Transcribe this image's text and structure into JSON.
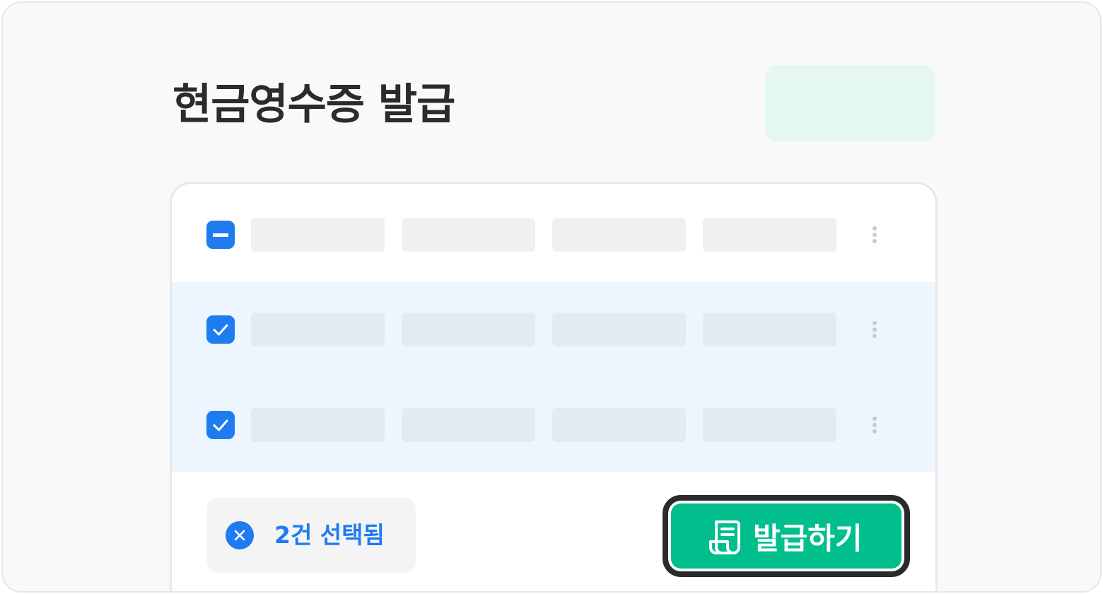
{
  "header": {
    "title": "현금영수증 발급"
  },
  "table": {
    "rows": [
      {
        "state": "indeterminate",
        "selected": false
      },
      {
        "state": "checked",
        "selected": true
      },
      {
        "state": "checked",
        "selected": true
      }
    ]
  },
  "footer": {
    "selection_label": "2건 선택됨",
    "issue_button_label": "발급하기"
  },
  "colors": {
    "accent_blue": "#1e7bf0",
    "primary_green": "#00bf8d",
    "selected_row_bg": "#edf5fe",
    "header_chip_bg": "#e5f7f1"
  },
  "icons": {
    "header_checkbox": "minus-icon",
    "row_checkbox": "checkmark-icon",
    "row_menu": "more-vertical-icon",
    "clear": "close-icon",
    "issue": "receipt-icon"
  }
}
